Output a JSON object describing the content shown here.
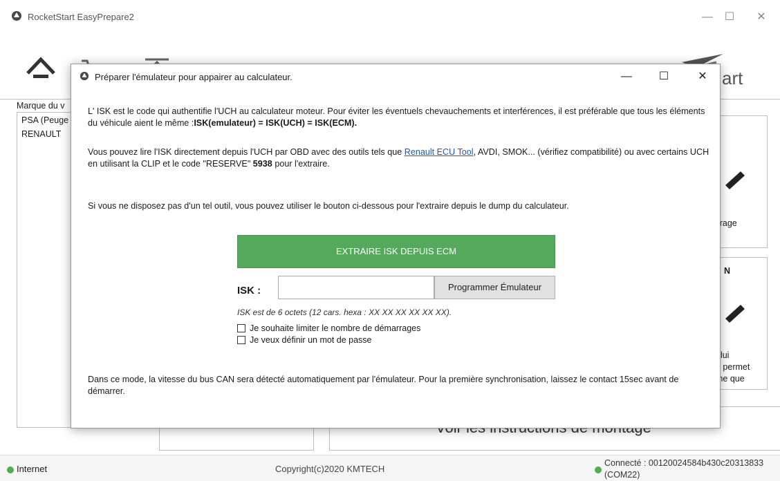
{
  "app": {
    "title": "RocketStart EasyPrepare2",
    "window_controls": {
      "minimize": "—",
      "maximize": "☐",
      "close": "✕"
    }
  },
  "sidebar": {
    "label": "Marque du v",
    "items": [
      {
        "label": "PSA (Peuge"
      },
      {
        "label": "RENAULT"
      }
    ]
  },
  "cards": {
    "card1_text": "airage",
    "card2_line1": "elui",
    "card2_line2": "n permet",
    "card2_line3": "me que",
    "card2_mark": "N"
  },
  "footer_panel": {
    "instructions": "Voir les instructions de montage"
  },
  "status": {
    "internet": "Internet",
    "copyright": "Copyright(c)2020 KMTECH",
    "connected_line1": "Connecté : 00120024584b430c20313833",
    "connected_line2": "(COM22)"
  },
  "dialog": {
    "title": "Préparer l'émulateur pour appairer au calculateur.",
    "controls": {
      "minimize": "—",
      "maximize": "☐",
      "close": "✕"
    },
    "p1_a": "L' ISK est le code qui authentifie l'UCH au calculateur moteur. Pour éviter les éventuels chevauchements et interférences, il est préférable que tous les éléments du véhicule aient le même :",
    "p1_b": "ISK(emulateur) = ISK(UCH) = ISK(ECM).",
    "p2_a": "Vous pouvez lire l'ISK directement depuis l'UCH par OBD avec des outils tels que ",
    "p2_link": "Renault ECU Tool",
    "p2_b": ", AVDI, SMOK... (vérifiez compatibilité) ou avec certains UCH en utilisant la CLIP et le code \"RESERVE\" ",
    "p2_code": "5938",
    "p2_c": " pour l'extraire.",
    "p3": "Si vous ne disposez pas d'un tel outil, vous pouvez utiliser le bouton ci-dessous pour l'extraire depuis le dump du calculateur.",
    "extract_button": "EXTRAIRE ISK DEPUIS ECM",
    "isk_label": "ISK :",
    "isk_value": "",
    "program_button": "Programmer Émulateur",
    "isk_hint": "ISK est de 6 octets (12 cars. hexa : XX XX XX XX XX XX).",
    "checkbox_limit": "Je souhaite limiter le nombre de démarrages",
    "checkbox_password": "Je veux définir un mot de passe",
    "p4": "Dans ce mode, la vitesse du bus CAN sera détecté automatiquement par l'émulateur. Pour la première synchronisation, laissez le contact 15sec avant de démarrer."
  },
  "colors": {
    "accent_green": "#55a95c",
    "status_green": "#4caf50",
    "link_blue": "#1a56c9"
  }
}
